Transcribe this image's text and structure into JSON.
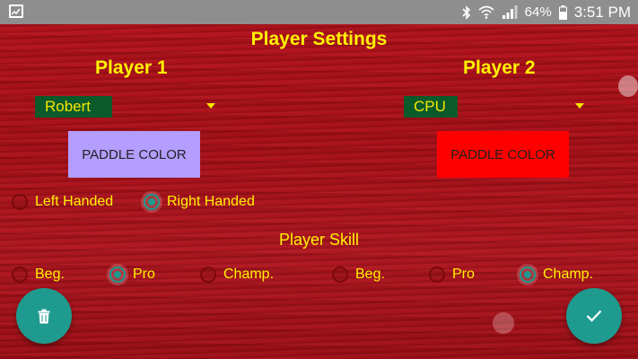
{
  "status_bar": {
    "left_icon": "gallery-icon",
    "icons": [
      "bluetooth-icon",
      "wifi-icon",
      "signal-icon",
      "battery-icon"
    ],
    "battery": "64%",
    "time": "3:51 PM"
  },
  "title": "Player Settings",
  "player1": {
    "heading": "Player 1",
    "name": "Robert",
    "paddle_label": "PADDLE COLOR",
    "paddle_color": "#b39dff",
    "handedness": [
      {
        "label": "Left Handed",
        "checked": false
      },
      {
        "label": "Right Handed",
        "checked": true
      }
    ],
    "skill": [
      {
        "label": "Beg.",
        "checked": false
      },
      {
        "label": "Pro",
        "checked": true
      },
      {
        "label": "Champ.",
        "checked": false
      }
    ]
  },
  "player2": {
    "heading": "Player 2",
    "name": "CPU",
    "paddle_label": "PADDLE COLOR",
    "paddle_color": "#ff0000",
    "skill": [
      {
        "label": "Beg.",
        "checked": false
      },
      {
        "label": "Pro",
        "checked": false
      },
      {
        "label": "Champ.",
        "checked": true
      }
    ]
  },
  "skill_heading": "Player Skill",
  "actions": {
    "delete_icon": "trash-icon",
    "confirm_icon": "checkmark-icon"
  },
  "colors": {
    "accent": "#1e9a8e",
    "text": "#fff200",
    "dropdown_bg": "#0a5a2a",
    "background": "#b5121c"
  }
}
